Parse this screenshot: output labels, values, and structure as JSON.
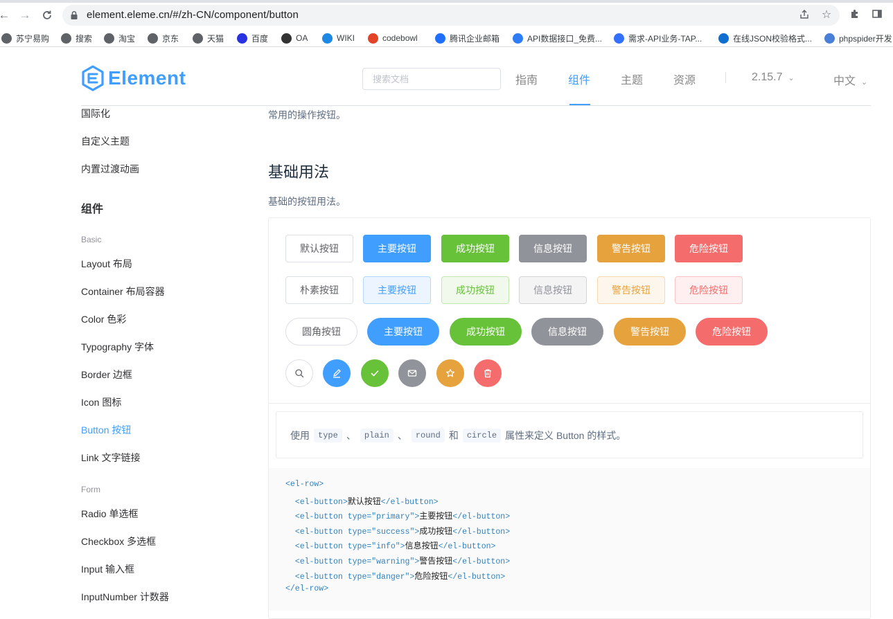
{
  "browser": {
    "url": "element.eleme.cn/#/zh-CN/component/button",
    "bookmarks": [
      {
        "label": "苏宁易购",
        "icon": "globe-icon",
        "color": "#5f6368"
      },
      {
        "label": "搜索",
        "icon": "globe-icon",
        "color": "#5f6368"
      },
      {
        "label": "淘宝",
        "icon": "globe-icon",
        "color": "#5f6368"
      },
      {
        "label": "京东",
        "icon": "globe-icon",
        "color": "#5f6368"
      },
      {
        "label": "天猫",
        "icon": "globe-icon",
        "color": "#5f6368"
      },
      {
        "label": "百度",
        "icon": "baidu-paw-icon",
        "color": "#2932e1"
      },
      {
        "label": "OA",
        "icon": "oa-logo-icon",
        "color": "#333333"
      },
      {
        "label": "WIKI",
        "icon": "check-mark-icon",
        "color": "#1e88e5"
      },
      {
        "label": "codebowl",
        "icon": "gitlab-fox-icon",
        "color": "#e24329"
      },
      {
        "label": "腾讯企业邮箱",
        "icon": "tencent-mail-icon",
        "color": "#1e6fff"
      },
      {
        "label": "API数据接口_免费...",
        "icon": "api-logo-icon",
        "color": "#2e7df6"
      },
      {
        "label": "需求-API业务-TAP...",
        "icon": "tapd-icon",
        "color": "#3370ff"
      },
      {
        "label": "在线JSON校验格式...",
        "icon": "json-icon",
        "color": "#0f6fd1"
      },
      {
        "label": "phpspider开发",
        "icon": "layers-icon",
        "color": "#4a7fd8"
      }
    ]
  },
  "header": {
    "logo_text": "Element",
    "search_placeholder": "搜索文档",
    "nav": [
      {
        "label": "指南",
        "active": false
      },
      {
        "label": "组件",
        "active": true
      },
      {
        "label": "主题",
        "active": false
      },
      {
        "label": "资源",
        "active": false
      }
    ],
    "version": "2.15.7",
    "language": "中文"
  },
  "sidebar": {
    "links_top": [
      "国际化",
      "自定义主题",
      "内置过渡动画"
    ],
    "group_title": "组件",
    "basic_title": "Basic",
    "basic_items": [
      "Layout 布局",
      "Container 布局容器",
      "Color 色彩",
      "Typography 字体",
      "Border 边框",
      "Icon 图标",
      "Button 按钮",
      "Link 文字链接"
    ],
    "active_item": "Button 按钮",
    "form_title": "Form",
    "form_items": [
      "Radio 单选框",
      "Checkbox 多选框",
      "Input 输入框",
      "InputNumber 计数器"
    ]
  },
  "main": {
    "intro": "常用的操作按钮。",
    "section_title": "基础用法",
    "section_desc": "基础的按钮用法。",
    "button_labels": [
      "默认按钮",
      "主要按钮",
      "成功按钮",
      "信息按钮",
      "警告按钮",
      "危险按钮"
    ],
    "plain_first": "朴素按钮",
    "round_first": "圆角按钮",
    "circle_icons": [
      "search-icon",
      "edit-icon",
      "check-icon",
      "message-icon",
      "star-icon",
      "delete-icon"
    ],
    "colors": {
      "primary": "#409eff",
      "success": "#67c23a",
      "info": "#909399",
      "warning": "#e6a23c",
      "danger": "#f56c6c"
    },
    "description": {
      "prefix": "使用",
      "code1": "type",
      "sep1": "、",
      "code2": "plain",
      "sep2": "、",
      "code3": "round",
      "conj": "和",
      "code4": "circle",
      "suffix": "属性来定义 Button 的样式。"
    },
    "code_lines": [
      {
        "indent": "",
        "parts": [
          [
            "tag",
            "<el-row>"
          ]
        ]
      },
      {
        "indent": "  ",
        "parts": [
          [
            "tag",
            "<el-button>"
          ],
          [
            "txt",
            "默认按钮"
          ],
          [
            "tag",
            "</el-button>"
          ]
        ]
      },
      {
        "indent": "  ",
        "parts": [
          [
            "tag",
            "<el-button "
          ],
          [
            "attr",
            "type="
          ],
          [
            "str",
            "\"primary\""
          ],
          [
            "tag",
            ">"
          ],
          [
            "txt",
            "主要按钮"
          ],
          [
            "tag",
            "</el-button>"
          ]
        ]
      },
      {
        "indent": "  ",
        "parts": [
          [
            "tag",
            "<el-button "
          ],
          [
            "attr",
            "type="
          ],
          [
            "str",
            "\"success\""
          ],
          [
            "tag",
            ">"
          ],
          [
            "txt",
            "成功按钮"
          ],
          [
            "tag",
            "</el-button>"
          ]
        ]
      },
      {
        "indent": "  ",
        "parts": [
          [
            "tag",
            "<el-button "
          ],
          [
            "attr",
            "type="
          ],
          [
            "str",
            "\"info\""
          ],
          [
            "tag",
            ">"
          ],
          [
            "txt",
            "信息按钮"
          ],
          [
            "tag",
            "</el-button>"
          ]
        ]
      },
      {
        "indent": "  ",
        "parts": [
          [
            "tag",
            "<el-button "
          ],
          [
            "attr",
            "type="
          ],
          [
            "str",
            "\"warning\""
          ],
          [
            "tag",
            ">"
          ],
          [
            "txt",
            "警告按钮"
          ],
          [
            "tag",
            "</el-button>"
          ]
        ]
      },
      {
        "indent": "  ",
        "parts": [
          [
            "tag",
            "<el-button "
          ],
          [
            "attr",
            "type="
          ],
          [
            "str",
            "\"danger\""
          ],
          [
            "tag",
            ">"
          ],
          [
            "txt",
            "危险按钮"
          ],
          [
            "tag",
            "</el-button>"
          ]
        ]
      },
      {
        "indent": "",
        "parts": [
          [
            "tag",
            "</el-row>"
          ]
        ]
      }
    ]
  }
}
